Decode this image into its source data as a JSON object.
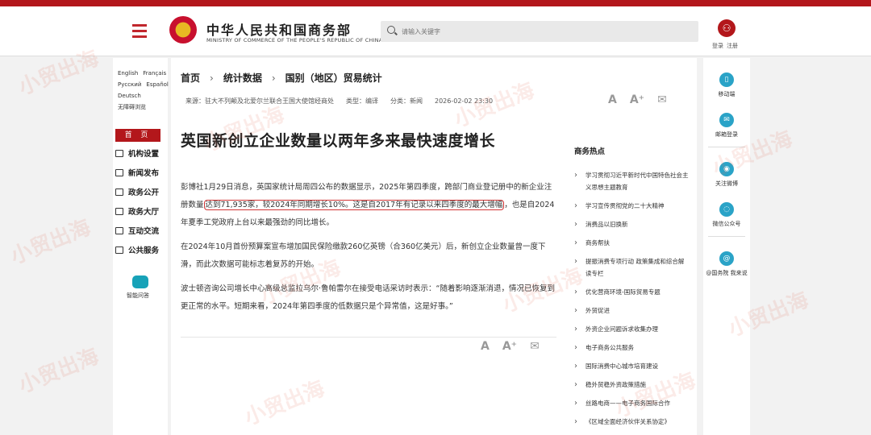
{
  "header": {
    "org_cn": "中华人民共和国商务部",
    "org_en": "MINISTRY OF COMMERCE OF THE PEOPLE'S REPUBLIC OF CHINA",
    "search_placeholder": "请输入关键字",
    "login": "登录",
    "register": "注册"
  },
  "left": {
    "langs": [
      "English",
      "Français",
      "Русский",
      "Español",
      "Deutsch",
      "无障碍浏览"
    ],
    "home": "首 页",
    "menu": [
      "机构设置",
      "新闻发布",
      "政务公开",
      "政务大厅",
      "互动交流",
      "公共服务"
    ],
    "robot_label": "智能问答"
  },
  "article": {
    "breadcrumb": [
      "首页",
      "统计数据",
      "国别（地区）贸易统计"
    ],
    "source": "来源：驻大不列颠及北爱尔兰联合王国大使馆经商处",
    "type": "类型：编译",
    "category": "分类：新闻",
    "datetime": "2026-02-02 23:30",
    "title": "英国新创立企业数量以两年多来最快速度增长",
    "p1a": "彭博社1月29日消息，英国家统计局周四公布的数据显示，2025年第四季度，跨部门商业登记册中的新企业注册数量",
    "p1hl": "达到71,935家，较2024年同期增长10%。这是自2017年有记录以来四季度的最大增幅",
    "p1b": "，也是自2024年夏季工党政府上台以来最强劲的同比增长。",
    "p2": "在2024年10月首份预算案宣布增加国民保险缴款260亿英镑（合360亿美元）后，新创立企业数量曾一度下滑，而此次数据可能标志着复苏的开始。",
    "p3": "波士顿咨询公司增长中心高级总监拉乌尔·鲁帕雷尔在接受电话采访时表示：“随着影响逐渐消退，情况已恢复到更正常的水平。短期来看，2024年第四季度的低数据只是个异常值，这是好事。”"
  },
  "hot": {
    "title": "商务热点",
    "items": [
      "学习贯彻习近平新时代中国特色社会主义思想主题教育",
      "学习宣传贯彻党的二十大精神",
      "消费品以旧换新",
      "商务帮扶",
      "提振消费专项行动 政策集成和综合解读专栏",
      "优化营商环境-国际贸易专题",
      "外贸促进",
      "外资企业问题诉求收集办理",
      "电子商务公共服务",
      "国际消费中心城市培育建设",
      "稳外贸稳外资政策措施",
      "丝路电商——电子商务国际合作",
      "《区域全面经济伙伴关系协定》"
    ]
  },
  "right": {
    "items": [
      "移动端",
      "邮箱登录",
      "关注微博",
      "微信公众号",
      "@国务院 我来说"
    ]
  },
  "tools": {
    "font_small": "A",
    "font_large": "A⁺"
  },
  "watermark": "小贸出海"
}
